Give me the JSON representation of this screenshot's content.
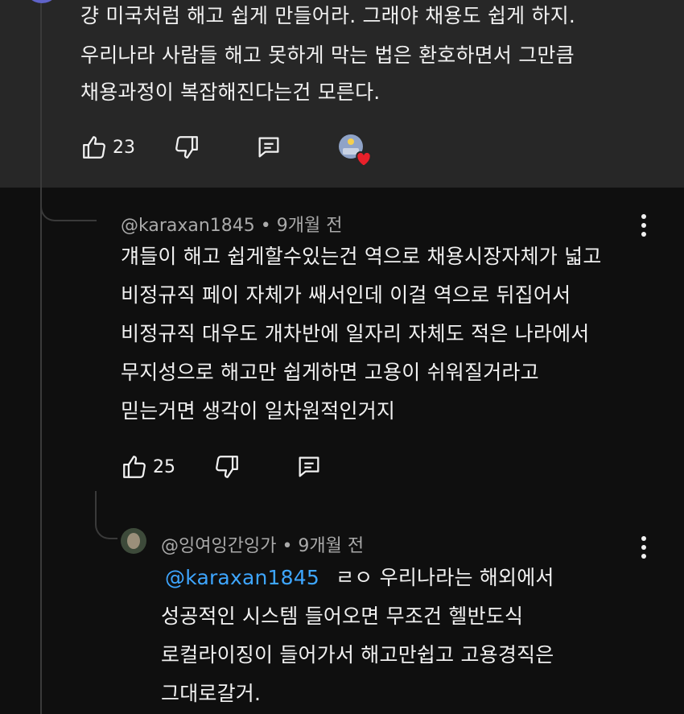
{
  "parent_comment": {
    "lines": [
      "걍 미국처럼 해고 쉽게 만들어라. 그래야 채용도 쉽게 하지.",
      "우리나라 사람들 해고 못하게 막는 법은 환호하면서 그만큼",
      "채용과정이 복잡해진다는건 모른다."
    ],
    "likes": "23"
  },
  "reply1": {
    "handle": "@karaxan1845",
    "time": "• 9개월 전",
    "lines": [
      "걔들이 해고 쉽게할수있는건 역으로 채용시장자체가 넓고",
      "비정규직 페이 자체가 쌔서인데 이걸 역으로 뒤집어서",
      "비정규직 대우도 개차반에 일자리 자체도 적은 나라에서",
      "무지성으로 해고만 쉽게하면 고용이 쉬워질거라고",
      "믿는거면 생각이 일차원적인거지"
    ],
    "likes": "25"
  },
  "reply2": {
    "handle": "@잉여잉간잉가",
    "time": "• 9개월 전",
    "mention": "@karaxan1845",
    "line1_rest": "ㄹㅇ 우리나라는 해외에서",
    "lines": [
      "성공적인 시스템 들어오면 무조건 헬반도식",
      "로컬라이징이 들어가서 해고만쉽고 고용경직은",
      "그대로갈거."
    ]
  },
  "icons": {
    "like": "thumbs-up-icon",
    "dislike": "thumbs-down-icon",
    "reply": "reply-comment-icon",
    "creator_heart": "creator-heart-icon",
    "menu": "more-vertical-icon"
  },
  "colors": {
    "page_bg": "#0f0f0f",
    "highlight_bg": "#272727",
    "text": "#f1f1f1",
    "meta": "#aaaaaa",
    "mention": "#3ea6ff",
    "heart": "#e8202a"
  }
}
